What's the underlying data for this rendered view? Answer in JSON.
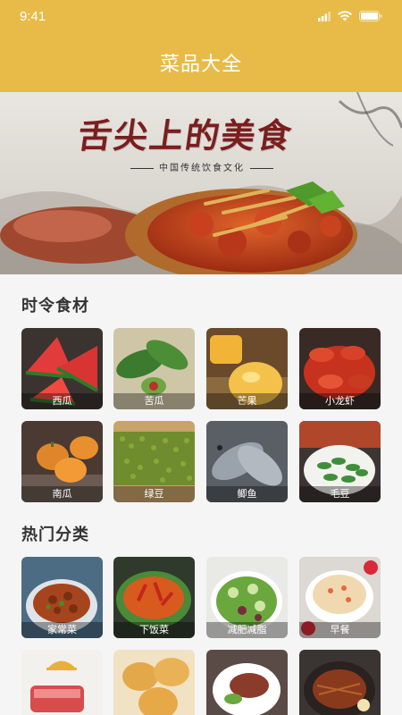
{
  "status": {
    "time": "9:41"
  },
  "header": {
    "title": "菜品大全"
  },
  "banner": {
    "title": "舌尖上的美食",
    "subtitle": "中国传统饮食文化"
  },
  "seasonal": {
    "title": "时令食材",
    "items": [
      {
        "label": "西瓜"
      },
      {
        "label": "苦瓜"
      },
      {
        "label": "芒果"
      },
      {
        "label": "小龙虾"
      },
      {
        "label": "南瓜"
      },
      {
        "label": "绿豆"
      },
      {
        "label": "鲫鱼"
      },
      {
        "label": "毛豆"
      }
    ]
  },
  "popular": {
    "title": "热门分类",
    "items": [
      {
        "label": "家常菜"
      },
      {
        "label": "下饭菜"
      },
      {
        "label": "减肥减脂"
      },
      {
        "label": "早餐"
      },
      {
        "label": ""
      },
      {
        "label": ""
      },
      {
        "label": ""
      },
      {
        "label": ""
      }
    ]
  },
  "colors": {
    "accent": "#e8bb48",
    "background": "#f5f5f5"
  }
}
